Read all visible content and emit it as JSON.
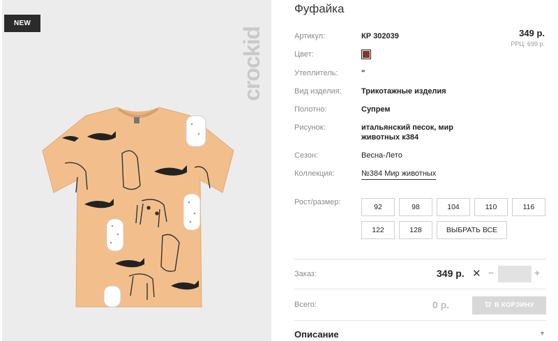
{
  "gallery": {
    "badge": "NEW",
    "brand": "crockid"
  },
  "product": {
    "title": "Фуфайка",
    "price": "349 р.",
    "rrp": "РРЦ: 699 р."
  },
  "attributes": [
    {
      "label": "Артикул:",
      "value": "КР 302039"
    },
    {
      "label": "Цвет:",
      "value": ""
    },
    {
      "label": "Утеплитель:",
      "value": "\""
    },
    {
      "label": "Вид изделия:",
      "value": "Трикотажные изделия"
    },
    {
      "label": "Полотно:",
      "value": "Супрем"
    },
    {
      "label": "Рисунок:",
      "value": "итальянский песок, мир",
      "value2": "животных к384"
    },
    {
      "label": "Сезон:",
      "value": "Весна-Лето"
    },
    {
      "label": "Коллекция:",
      "value": "№384 Мир животных"
    }
  ],
  "color": {
    "swatch": "#7a3a25"
  },
  "sizes": {
    "label": "Рост/размер:",
    "options": [
      "92",
      "98",
      "104",
      "110",
      "116",
      "122",
      "128"
    ],
    "select_all": "ВЫБРАТЬ ВСЕ"
  },
  "order": {
    "label": "Заказ:",
    "price": "349 р.",
    "times": "✕",
    "minus": "−",
    "plus": "+",
    "quantity": ""
  },
  "total": {
    "label": "Всего:",
    "value": "0 р.",
    "cart_button": "В КОРЗИНУ"
  },
  "description": {
    "label": "Описание",
    "caret": "▼"
  }
}
